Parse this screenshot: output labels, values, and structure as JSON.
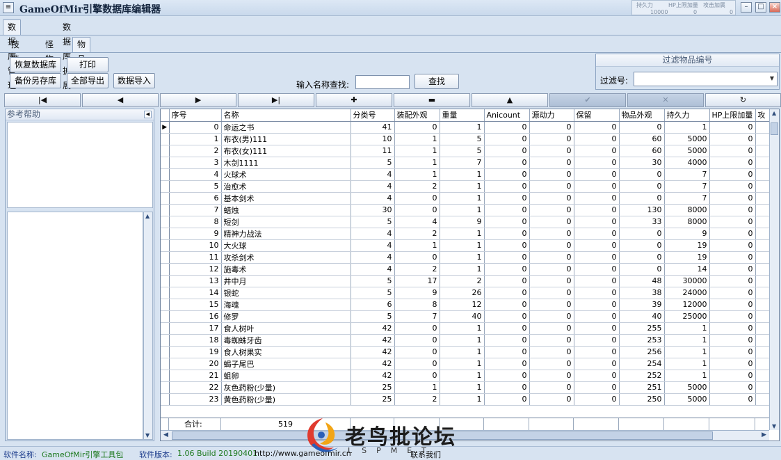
{
  "window": {
    "title": "GameOfMir引擎数据库编辑器",
    "mini_grid_headers": [
      "持久力",
      "HP上限加量",
      "攻击加属"
    ],
    "mini_grid_values": [
      "10000",
      "0",
      "0"
    ]
  },
  "tabs_main": [
    "数据库管理",
    "数据库扩展"
  ],
  "tabs_sub": [
    "技能",
    "怪物",
    "物品"
  ],
  "toolbar": {
    "restore": "恢复数据库",
    "print": "打印",
    "backup": "备份另存库",
    "export_all": "全部导出",
    "import": "数据导入",
    "search_label": "输入名称查找:",
    "search_value": "",
    "search_button": "查找"
  },
  "filter": {
    "title": "过滤物品编号",
    "label": "过滤号:",
    "value": ""
  },
  "navigator": [
    "first",
    "prior",
    "next",
    "last",
    "insert",
    "delete",
    "edit",
    "post",
    "cancel",
    "refresh"
  ],
  "help": {
    "title": "参考帮助"
  },
  "grid": {
    "columns": [
      "序号",
      "名称",
      "分类号",
      "装配外观",
      "重量",
      "Anicount",
      "源动力",
      "保留",
      "物品外观",
      "持久力",
      "HP上限加量",
      "攻"
    ],
    "rows": [
      [
        "0",
        "命运之书",
        "41",
        "0",
        "1",
        "0",
        "0",
        "0",
        "0",
        "1",
        "0"
      ],
      [
        "1",
        "布衣(男)111",
        "10",
        "1",
        "5",
        "0",
        "0",
        "0",
        "60",
        "5000",
        "0"
      ],
      [
        "2",
        "布衣(女)111",
        "11",
        "1",
        "5",
        "0",
        "0",
        "0",
        "60",
        "5000",
        "0"
      ],
      [
        "3",
        "木剑1111",
        "5",
        "1",
        "7",
        "0",
        "0",
        "0",
        "30",
        "4000",
        "0"
      ],
      [
        "4",
        "火球术",
        "4",
        "1",
        "1",
        "0",
        "0",
        "0",
        "0",
        "7",
        "0"
      ],
      [
        "5",
        "治愈术",
        "4",
        "2",
        "1",
        "0",
        "0",
        "0",
        "0",
        "7",
        "0"
      ],
      [
        "6",
        "基本剑术",
        "4",
        "0",
        "1",
        "0",
        "0",
        "0",
        "0",
        "7",
        "0"
      ],
      [
        "7",
        "蜡烛",
        "30",
        "0",
        "1",
        "0",
        "0",
        "0",
        "130",
        "8000",
        "0"
      ],
      [
        "8",
        "短剑",
        "5",
        "4",
        "9",
        "0",
        "0",
        "0",
        "33",
        "8000",
        "0"
      ],
      [
        "9",
        "精神力战法",
        "4",
        "2",
        "1",
        "0",
        "0",
        "0",
        "0",
        "9",
        "0"
      ],
      [
        "10",
        "大火球",
        "4",
        "1",
        "1",
        "0",
        "0",
        "0",
        "0",
        "19",
        "0"
      ],
      [
        "11",
        "攻杀剑术",
        "4",
        "0",
        "1",
        "0",
        "0",
        "0",
        "0",
        "19",
        "0"
      ],
      [
        "12",
        "施毒术",
        "4",
        "2",
        "1",
        "0",
        "0",
        "0",
        "0",
        "14",
        "0"
      ],
      [
        "13",
        "井中月",
        "5",
        "17",
        "2",
        "0",
        "0",
        "0",
        "48",
        "30000",
        "0"
      ],
      [
        "14",
        "银蛇",
        "5",
        "9",
        "26",
        "0",
        "0",
        "0",
        "38",
        "24000",
        "0"
      ],
      [
        "15",
        "海魂",
        "6",
        "8",
        "12",
        "0",
        "0",
        "0",
        "39",
        "12000",
        "0"
      ],
      [
        "16",
        "修罗",
        "5",
        "7",
        "40",
        "0",
        "0",
        "0",
        "40",
        "25000",
        "0"
      ],
      [
        "17",
        "食人树叶",
        "42",
        "0",
        "1",
        "0",
        "0",
        "0",
        "255",
        "1",
        "0"
      ],
      [
        "18",
        "毒蜘蛛牙齿",
        "42",
        "0",
        "1",
        "0",
        "0",
        "0",
        "253",
        "1",
        "0"
      ],
      [
        "19",
        "食人树果实",
        "42",
        "0",
        "1",
        "0",
        "0",
        "0",
        "256",
        "1",
        "0"
      ],
      [
        "20",
        "蝎子尾巴",
        "42",
        "0",
        "1",
        "0",
        "0",
        "0",
        "254",
        "1",
        "0"
      ],
      [
        "21",
        "蛆卵",
        "42",
        "0",
        "1",
        "0",
        "0",
        "0",
        "252",
        "1",
        "0"
      ],
      [
        "22",
        "灰色药粉(少量)",
        "25",
        "1",
        "1",
        "0",
        "0",
        "0",
        "251",
        "5000",
        "0"
      ],
      [
        "23",
        "黄色药粉(少量)",
        "25",
        "2",
        "1",
        "0",
        "0",
        "0",
        "250",
        "5000",
        "0"
      ]
    ],
    "summary_label": "合计:",
    "summary_value": "519"
  },
  "status": {
    "name_label": "软件名称:",
    "name_value": "GameOfMir引擎工具包",
    "version_label": "软件版本:",
    "version_value": "1.06 Build 20190401",
    "url": "http://www.gameofmir.cn",
    "contact": "联系我们"
  },
  "watermark": {
    "text": "老鸟批论坛",
    "sub": "LSPMET"
  }
}
